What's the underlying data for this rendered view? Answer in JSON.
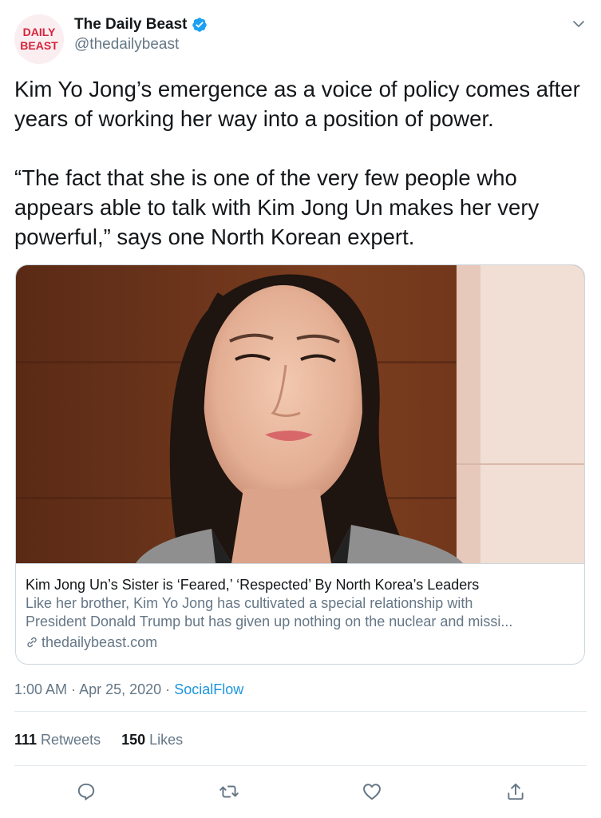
{
  "author": {
    "name": "The Daily Beast",
    "handle": "@thedailybeast",
    "avatar_text_line1": "DAILY",
    "avatar_text_line2": "BEAST"
  },
  "tweet": {
    "paragraph1": "Kim Yo Jong’s emergence as a voice of policy comes after years of working her way into a position of power.",
    "paragraph2": "“The fact that she is one of the very few people who appears able to talk with Kim Jong Un makes her very powerful,” says one North Korean expert."
  },
  "card": {
    "title": "Kim Jong Un’s Sister is ‘Feared,’ ‘Respected’ By North Korea’s Leaders",
    "desc_line1": "Like her brother, Kim Yo Jong has cultivated a special relationship with",
    "desc_line2": "President Donald Trump but has given up nothing on the nuclear and missi...",
    "domain": "thedailybeast.com"
  },
  "meta": {
    "time": "1:00 AM",
    "date": "Apr 25, 2020",
    "separator": "·",
    "source": "SocialFlow"
  },
  "stats": {
    "retweets_count": "111",
    "retweets_label": "Retweets",
    "likes_count": "150",
    "likes_label": "Likes"
  },
  "colors": {
    "text": "#14171a",
    "secondary": "#657786",
    "accent": "#1b95e0",
    "brand": "#d6243a"
  },
  "icons": [
    "verified-icon",
    "chevron-down-icon",
    "link-icon",
    "reply-icon",
    "retweet-icon",
    "like-icon",
    "share-icon"
  ]
}
